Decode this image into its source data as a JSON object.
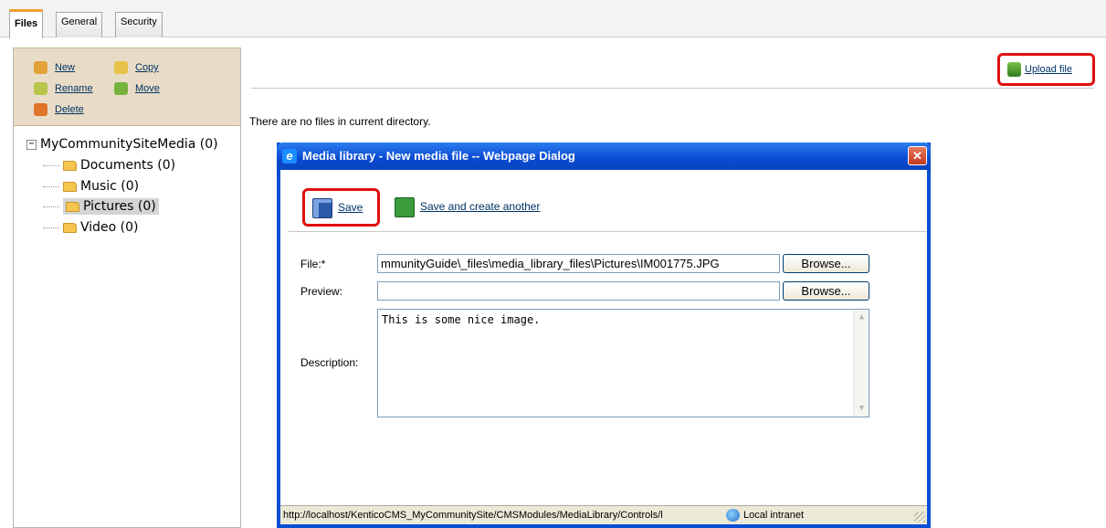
{
  "tabs": [
    {
      "label": "Files",
      "active": true
    },
    {
      "label": "General",
      "active": false
    },
    {
      "label": "Security",
      "active": false
    }
  ],
  "actions": {
    "new": "New",
    "copy": "Copy",
    "rename": "Rename",
    "move": "Move",
    "delete": "Delete"
  },
  "tree": {
    "root": "MyCommunitySiteMedia (0)",
    "items": [
      {
        "label": "Documents (0)",
        "selected": false
      },
      {
        "label": "Music (0)",
        "selected": false
      },
      {
        "label": "Pictures (0)",
        "selected": true
      },
      {
        "label": "Video (0)",
        "selected": false
      }
    ]
  },
  "main": {
    "upload_label": "Upload file",
    "empty_message": "There are no files in current directory."
  },
  "dialog": {
    "title": "Media library - New media file -- Webpage Dialog",
    "close_glyph": "✕",
    "save_label": "Save",
    "save_another_label": "Save and create another",
    "file_label": "File:*",
    "file_value": "mmunityGuide\\_files\\media_library_files\\Pictures\\IM001775.JPG",
    "preview_label": "Preview:",
    "preview_value": "",
    "browse_label": "Browse...",
    "description_label": "Description:",
    "description_value": "This is some nice image.",
    "status_url": "http://localhost/KenticoCMS_MyCommunitySite/CMSModules/MediaLibrary/Controls/l",
    "status_zone": "Local intranet"
  },
  "colors": {
    "highlight_box": "#e01010",
    "title_bar": "#0a4ad0",
    "action_panel": "#e8dcc6",
    "link": "#003366"
  }
}
